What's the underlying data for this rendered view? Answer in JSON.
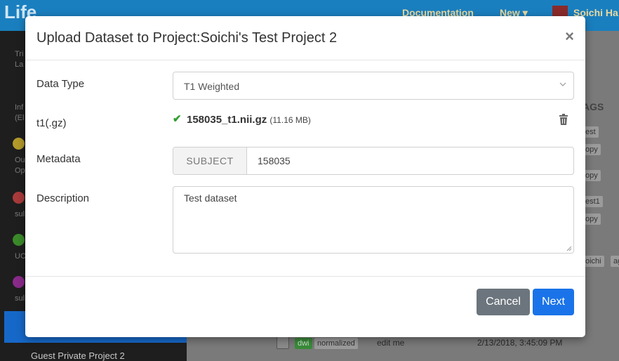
{
  "app": {
    "brand": "Life",
    "nav": {
      "documentation": "Documentation",
      "new": "New",
      "user": "Soichi Ha"
    }
  },
  "sidebar": {
    "items": [
      {
        "line1": "Tri",
        "line2": "La"
      },
      {
        "line1": "Inf",
        "line2": "(El"
      },
      {
        "line1": "Ou",
        "line2": "Op"
      },
      {
        "line1": "sul",
        "line2": ""
      },
      {
        "line1": "UC",
        "line2": ""
      },
      {
        "line1": "sul",
        "line2": ""
      }
    ],
    "guest_project": "Guest Private Project 2"
  },
  "background_table": {
    "tags_header": "AGS",
    "tags": [
      "est",
      "opy",
      "opy",
      "est1",
      "opy",
      "oichi",
      "ag"
    ],
    "last_row": {
      "datatype_tag": "dwi",
      "normalized_tag": "normalized",
      "description": "edit me",
      "date": "2/13/2018, 3:45:09 PM"
    }
  },
  "modal": {
    "title": "Upload Dataset to Project:Soichi's Test Project 2",
    "close_label": "×",
    "data_type": {
      "label": "Data Type",
      "selected": "T1 Weighted"
    },
    "file": {
      "label": "t1(.gz)",
      "name": "158035_t1.nii.gz",
      "size": "(11.16 MB)"
    },
    "metadata": {
      "label": "Metadata",
      "addon": "SUBJECT",
      "value": "158035"
    },
    "description": {
      "label": "Description",
      "value": "Test dataset"
    },
    "buttons": {
      "cancel": "Cancel",
      "next": "Next"
    }
  },
  "colors": {
    "topbar": "#1a7fbf",
    "primary": "#1a73e8",
    "secondary": "#6c757d",
    "success": "#2e9e2e"
  }
}
